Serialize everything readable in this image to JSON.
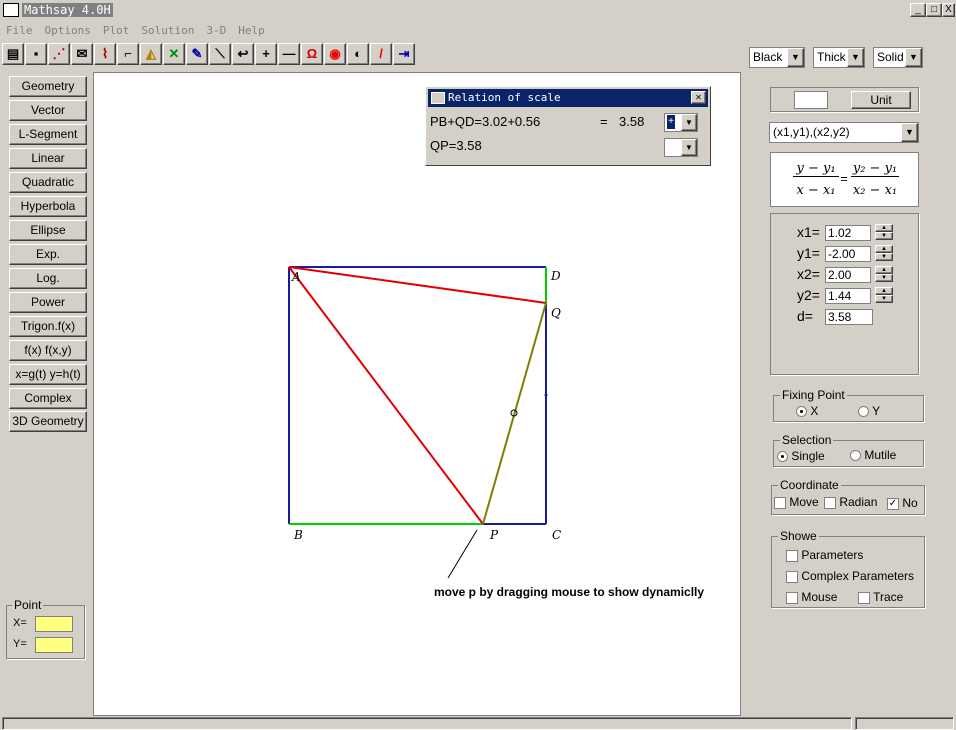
{
  "window": {
    "title": "Mathsay 4.0H",
    "controls": [
      "_",
      "□",
      "X"
    ]
  },
  "menu": [
    "File",
    "Options",
    "Plot",
    "Solution",
    "3-D",
    "Help"
  ],
  "toolbar": {
    "icons": [
      "open-icon",
      "save-icon",
      "plot-icon",
      "envelope-icon",
      "chart-icon",
      "angle-icon",
      "triangle-icon",
      "scale-icon",
      "pen-icon",
      "line-icon",
      "arrow-icon",
      "plus-icon",
      "minus-icon",
      "magnet-icon",
      "target-icon",
      "half-circle-icon",
      "pencil-icon",
      "exit-icon"
    ]
  },
  "style_selects": {
    "color": "Black",
    "width": "Thick",
    "line": "Solid"
  },
  "left_buttons": [
    "Geometry",
    "Vector",
    "L-Segment",
    "Linear",
    "Quadratic",
    "Hyperbola",
    "Ellipse",
    "Exp.",
    "Log.",
    "Power",
    "Trigon.f(x)",
    "f(x)  f(x,y)",
    "x=g(t) y=h(t)",
    "Complex",
    "3D Geometry"
  ],
  "point_panel": {
    "title": "Point",
    "x_label": "X=",
    "y_label": "Y=",
    "x_value": "",
    "y_value": ""
  },
  "dialog": {
    "title": "Relation of scale",
    "line1": "PB+QD=3.02+0.56",
    "equals": "=",
    "value": "3.58",
    "sign": "+",
    "line2": "QP=3.58"
  },
  "figure": {
    "labels": {
      "A": "A",
      "D": "D",
      "Q": "Q",
      "B": "B",
      "P": "P",
      "C": "C"
    },
    "caption": "move p by dragging mouse to show dynamiclly",
    "colors": {
      "square": "#00008b",
      "red": "#e00000",
      "green": "#00d000",
      "olive": "#808000"
    }
  },
  "right_panel": {
    "unit_value": "",
    "unit_button": "Unit",
    "mode_select": "(x1,y1),(x2,y2)",
    "formula": {
      "lhs_num": "y − y₁",
      "lhs_den": "x − x₁",
      "eq": "=",
      "rhs_num": "y₂ − y₁",
      "rhs_den": "x₂ − x₁"
    },
    "params": [
      {
        "label": "x1=",
        "value": "1.02"
      },
      {
        "label": "y1=",
        "value": "-2.00"
      },
      {
        "label": "x2=",
        "value": "2.00"
      },
      {
        "label": "y2=",
        "value": "1.44"
      }
    ],
    "d_label": "d=",
    "d_value": "3.58",
    "fixing_point": {
      "title": "Fixing Point",
      "x": "X",
      "y": "Y",
      "selected": "X"
    },
    "selection": {
      "title": "Selection",
      "single": "Single",
      "mutile": "Mutile",
      "selected": "Single"
    },
    "coordinate": {
      "title": "Coordinate",
      "move": "Move",
      "radian": "Radian",
      "no": "No",
      "no_checked": true
    },
    "showe": {
      "title": "Showe",
      "parameters": "Parameters",
      "complex": "Complex Parameters",
      "mouse": "Mouse",
      "trace": "Trace"
    }
  }
}
